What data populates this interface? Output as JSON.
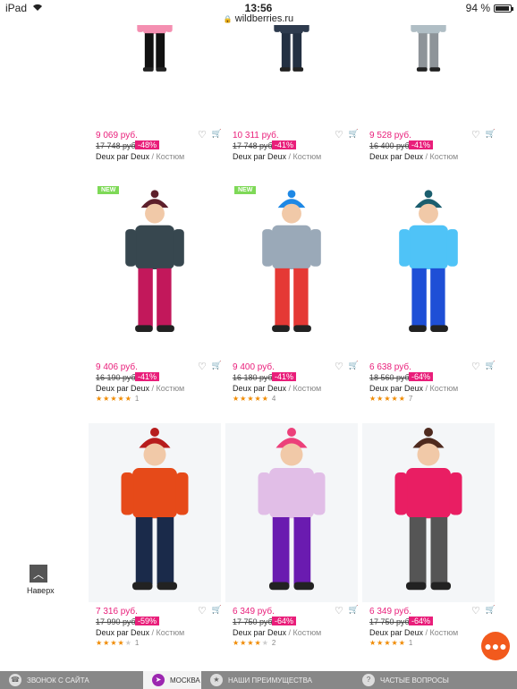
{
  "status": {
    "device": "iPad",
    "time": "13:56",
    "url": "wildberries.ru",
    "battery": "94 %",
    "battery_level": 0.94
  },
  "products": [
    {
      "price": "9 069 руб.",
      "old_price": "17 748 руб.",
      "discount": "-48%",
      "brand": "Deux par Deux",
      "category": "Костюм",
      "is_new": false,
      "rating": null,
      "reviews": null,
      "colors": {
        "jacket": "#f48fb1",
        "pants": "#111111",
        "hat": ""
      }
    },
    {
      "price": "10 311 руб.",
      "old_price": "17 748 руб.",
      "discount": "-41%",
      "brand": "Deux par Deux",
      "category": "Костюм",
      "is_new": false,
      "rating": null,
      "reviews": null,
      "colors": {
        "jacket": "#2e3b4e",
        "pants": "#233042",
        "hat": ""
      }
    },
    {
      "price": "9 528 руб.",
      "old_price": "16 400 руб.",
      "discount": "-41%",
      "brand": "Deux par Deux",
      "category": "Костюм",
      "is_new": false,
      "rating": null,
      "reviews": null,
      "colors": {
        "jacket": "#b0bec5",
        "pants": "#8e9499",
        "hat": ""
      }
    },
    {
      "price": "9 406 руб.",
      "old_price": "16 190 руб.",
      "discount": "-41%",
      "brand": "Deux par Deux",
      "category": "Костюм",
      "is_new": true,
      "new_label": "NEW",
      "rating": 5,
      "reviews": "1",
      "colors": {
        "jacket": "#37474f",
        "pants": "#c2185b",
        "hat": "#5d1f2b"
      }
    },
    {
      "price": "9 400 руб.",
      "old_price": "16 180 руб.",
      "discount": "-41%",
      "brand": "Deux par Deux",
      "category": "Костюм",
      "is_new": true,
      "new_label": "NEW",
      "rating": 5,
      "reviews": "4",
      "colors": {
        "jacket": "#9aa9b8",
        "pants": "#e53935",
        "hat": "#1e88e5"
      }
    },
    {
      "price": "6 638 руб.",
      "old_price": "18 560 руб.",
      "discount": "-64%",
      "brand": "Deux par Deux",
      "category": "Костюм",
      "is_new": false,
      "rating": 5,
      "reviews": "7",
      "colors": {
        "jacket": "#4fc3f7",
        "pants": "#1e4fd6",
        "hat": "#1b5e6e"
      }
    },
    {
      "price": "7 316 руб.",
      "old_price": "17 990 руб.",
      "discount": "-59%",
      "brand": "Deux par Deux",
      "category": "Костюм",
      "is_new": false,
      "rating": 4,
      "reviews": "1",
      "colors": {
        "jacket": "#e64a19",
        "pants": "#1a2a4a",
        "hat": "#b71c1c"
      }
    },
    {
      "price": "6 349 руб.",
      "old_price": "17 750 руб.",
      "discount": "-64%",
      "brand": "Deux par Deux",
      "category": "Костюм",
      "is_new": false,
      "rating": 4,
      "reviews": "2",
      "colors": {
        "jacket": "#e1bee7",
        "pants": "#6a1bb0",
        "hat": "#ec407a"
      }
    },
    {
      "price": "6 349 руб.",
      "old_price": "17 750 руб.",
      "discount": "-64%",
      "brand": "Deux par Deux",
      "category": "Костюм",
      "is_new": false,
      "rating": 5,
      "reviews": "1",
      "colors": {
        "jacket": "#e91e63",
        "pants": "#555555",
        "hat": "#4e2a1e"
      }
    }
  ],
  "scroll_top": {
    "label": "Наверх",
    "icon": "chevron-up-icon"
  },
  "chat": {
    "icon": "chat-bubble-icon",
    "color": "#f25a1d"
  },
  "bottom_bar": [
    {
      "label": "ЗВОНОК С САЙТА",
      "icon": "phone-icon",
      "active": false
    },
    {
      "label": "МОСКВА",
      "icon": "location-arrow-icon",
      "active": true
    },
    {
      "label": "НАШИ ПРЕИМУЩЕСТВА",
      "icon": "star-icon",
      "active": false
    },
    {
      "label": "ЧАСТЫЕ ВОПРОСЫ",
      "icon": "question-icon",
      "active": false
    }
  ],
  "accent": "#e91e7a"
}
